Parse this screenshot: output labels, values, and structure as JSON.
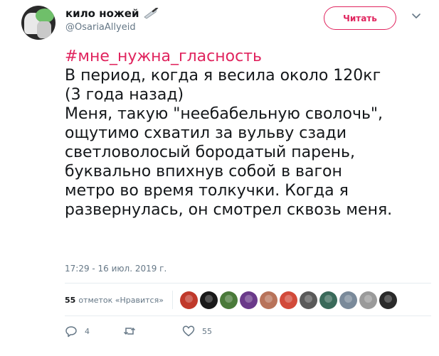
{
  "user": {
    "display_name": "кило ножей",
    "name_emoji": "knife-icon",
    "handle": "@OsariaAllyeid"
  },
  "follow_button": {
    "label": "Читать"
  },
  "tweet": {
    "hashtag": "#мне_нужна_гласность",
    "lines": [
      "В период, когда я весила около 120кг",
      "(3 года назад)",
      "Меня, такую \"неебабельную сволочь\",",
      "ощутимо схватил за вульву сзади",
      "светловолосый бородатый парень,",
      "буквально впихнув собой в вагон",
      "метро во время толкучки. Когда я",
      "развернулась, он смотрел сквозь меня."
    ],
    "timestamp": "17:29 - 16 июл. 2019 г."
  },
  "likes": {
    "count": "55",
    "label": "отметок «Нравится»",
    "avatar_colors": [
      "#c0392b",
      "#1a1a1a",
      "#4a7a3a",
      "#6a3a8a",
      "#b8735a",
      "#d24a3a",
      "#5a5a5a",
      "#3a6a5a",
      "#7a8a9a",
      "#9a9a9a",
      "#2a2a2a"
    ]
  },
  "actions": {
    "reply_icon": "reply-icon",
    "reply_count": "4",
    "retweet_icon": "retweet-icon",
    "retweet_count": "",
    "like_icon": "heart-icon",
    "like_count": "55"
  },
  "colors": {
    "accent": "#e0245e",
    "secondary_text": "#657786",
    "primary_text": "#14171a",
    "divider": "#e6ecf0"
  }
}
